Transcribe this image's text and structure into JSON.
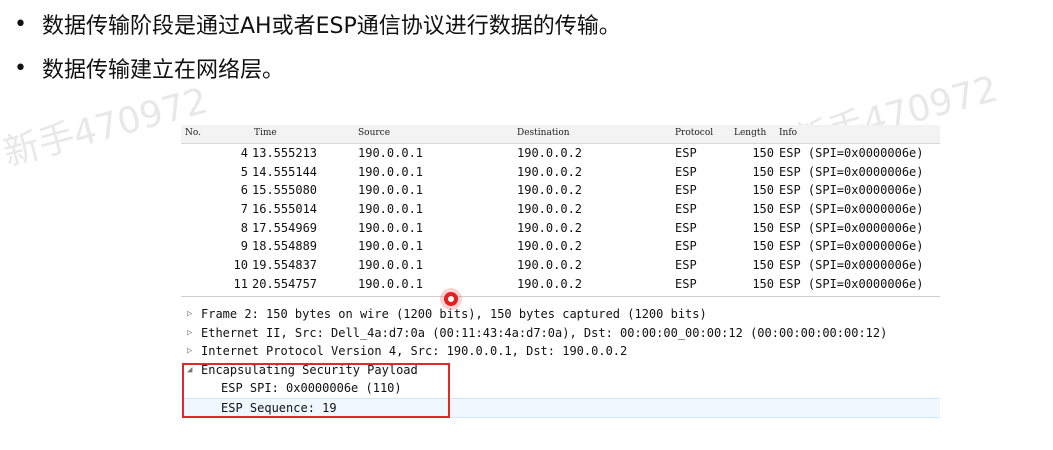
{
  "slide": {
    "bullets": [
      "数据传输阶段是通过AH或者ESP通信协议进行数据的传输。",
      "数据传输建立在网络层。"
    ],
    "bullet_marker": "•",
    "watermark": "新手470972"
  },
  "packet_list": {
    "headers": [
      "No.",
      "Time",
      "Source",
      "Destination",
      "Protocol",
      "Length",
      "Info"
    ],
    "rows": [
      {
        "no": "4",
        "time": "13.555213",
        "src": "190.0.0.1",
        "dst": "190.0.0.2",
        "proto": "ESP",
        "len": "150",
        "info": "ESP (SPI=0x0000006e)"
      },
      {
        "no": "5",
        "time": "14.555144",
        "src": "190.0.0.1",
        "dst": "190.0.0.2",
        "proto": "ESP",
        "len": "150",
        "info": "ESP (SPI=0x0000006e)"
      },
      {
        "no": "6",
        "time": "15.555080",
        "src": "190.0.0.1",
        "dst": "190.0.0.2",
        "proto": "ESP",
        "len": "150",
        "info": "ESP (SPI=0x0000006e)"
      },
      {
        "no": "7",
        "time": "16.555014",
        "src": "190.0.0.1",
        "dst": "190.0.0.2",
        "proto": "ESP",
        "len": "150",
        "info": "ESP (SPI=0x0000006e)"
      },
      {
        "no": "8",
        "time": "17.554969",
        "src": "190.0.0.1",
        "dst": "190.0.0.2",
        "proto": "ESP",
        "len": "150",
        "info": "ESP (SPI=0x0000006e)"
      },
      {
        "no": "9",
        "time": "18.554889",
        "src": "190.0.0.1",
        "dst": "190.0.0.2",
        "proto": "ESP",
        "len": "150",
        "info": "ESP (SPI=0x0000006e)"
      },
      {
        "no": "10",
        "time": "19.554837",
        "src": "190.0.0.1",
        "dst": "190.0.0.2",
        "proto": "ESP",
        "len": "150",
        "info": "ESP (SPI=0x0000006e)"
      },
      {
        "no": "11",
        "time": "20.554757",
        "src": "190.0.0.1",
        "dst": "190.0.0.2",
        "proto": "ESP",
        "len": "150",
        "info": "ESP (SPI=0x0000006e)"
      }
    ]
  },
  "details": {
    "expand_icon": "▷",
    "collapse_icon": "◢",
    "frame": "Frame 2: 150 bytes on wire (1200 bits), 150 bytes captured (1200 bits)",
    "ethernet": "Ethernet II, Src: Dell_4a:d7:0a (00:11:43:4a:d7:0a), Dst: 00:00:00_00:00:12 (00:00:00:00:00:12)",
    "ip": "Internet Protocol Version 4, Src: 190.0.0.1, Dst: 190.0.0.2",
    "esp": "Encapsulating Security Payload",
    "esp_spi": "ESP SPI: 0x0000006e (110)",
    "esp_seq": "ESP Sequence: 19"
  },
  "colors": {
    "highlight_box": "#e02a2a",
    "cursor": "#e41f1f"
  }
}
